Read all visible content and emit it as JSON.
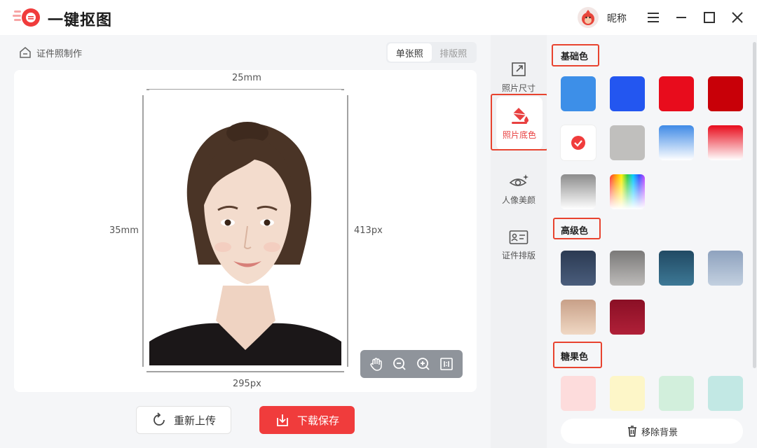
{
  "app": {
    "title": "一键抠图",
    "nickname": "昵称"
  },
  "breadcrumb": {
    "label": "证件照制作"
  },
  "mode_tabs": [
    {
      "label": "单张照",
      "selected": true
    },
    {
      "label": "排版照",
      "selected": false
    }
  ],
  "canvas": {
    "width_mm": "25mm",
    "height_mm": "35mm",
    "width_px": "295px",
    "height_px": "413px"
  },
  "toolbar": {
    "icons": [
      "hand-icon",
      "zoom-out-icon",
      "zoom-in-icon",
      "fit-ratio-icon"
    ]
  },
  "actions": {
    "reupload": "重新上传",
    "download": "下载保存"
  },
  "side_tabs": [
    {
      "label": "照片尺寸",
      "icon": "resize-icon",
      "active": false
    },
    {
      "label": "照片底色",
      "icon": "paint-bucket-icon",
      "active": true
    },
    {
      "label": "人像美颜",
      "icon": "eye-sparkle-icon",
      "active": false
    },
    {
      "label": "证件排版",
      "icon": "id-card-icon",
      "active": false
    }
  ],
  "colors": {
    "basic_title": "基础色",
    "basic": [
      "#3d8fe8",
      "#2356f0",
      "#e80c1c",
      "#c80008",
      "#ffffff",
      "#c0bfbd",
      "gradient-blue",
      "gradient-red",
      "gradient-gray",
      "gradient-rainbow"
    ],
    "selected": "#ffffff",
    "advanced_title": "高级色",
    "advanced": [
      "#334560",
      "#8a8a8c",
      "#2d5a78",
      "#93a9c8",
      "#d8b39a",
      "#9a1a30"
    ],
    "candy_title": "糖果色",
    "candy": [
      "#fddcdc",
      "#fdf6c8",
      "#d2efdc",
      "#c2e8e4"
    ]
  },
  "remove_background": "移除背景",
  "accent": "#f03c3c"
}
